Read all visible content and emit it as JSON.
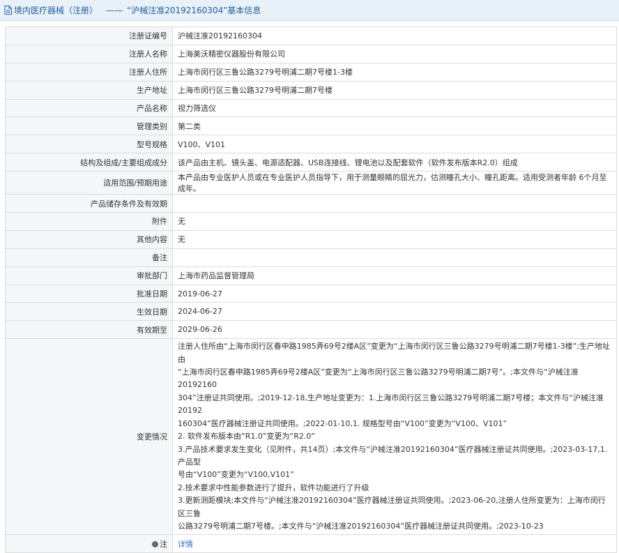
{
  "header": {
    "title": "境内医疗器械（注册）",
    "sep": "——",
    "subtitle": "“沪械注准20192160304”基本信息"
  },
  "rows": [
    {
      "label": "注册证编号",
      "value": "沪械注准20192160304"
    },
    {
      "label": "注册人名称",
      "value": "上海美沃精密仪器股份有限公司"
    },
    {
      "label": "注册人住所",
      "value": "上海市闵行区三鲁公路3279号明浦二期7号楼1-3楼"
    },
    {
      "label": "生产地址",
      "value": "上海市闵行区三鲁公路3279号明浦二期7号楼"
    },
    {
      "label": "产品名称",
      "value": "视力筛选仪"
    },
    {
      "label": "管理类别",
      "value": "第二类"
    },
    {
      "label": "型号规格",
      "value": "V100、V101"
    },
    {
      "label": "结构及组成/主要组成成分",
      "value": "该产品由主机、镜头盖、电源适配器、USB连接线、锂电池以及配套软件（软件发布版本R2.0）组成"
    },
    {
      "label": "适用范围/预期用途",
      "value": "本产品由专业医护人员或在专业医护人员指导下，用于测量眼睛的屈光力，估测瞳孔大小、瞳孔距离。适用受测者年龄 6个月至成年。"
    },
    {
      "label": "产品储存条件及有效期",
      "value": ""
    },
    {
      "label": "附件",
      "value": "无"
    },
    {
      "label": "其他内容",
      "value": "无"
    },
    {
      "label": "备注",
      "value": ""
    },
    {
      "label": "审批部门",
      "value": "上海市药品监督管理局"
    },
    {
      "label": "批准日期",
      "value": "2019-06-27"
    },
    {
      "label": "生效日期",
      "value": "2024-06-27"
    },
    {
      "label": "有效期至",
      "value": "2029-06-26"
    }
  ],
  "changes": {
    "label": "变更情况",
    "lines": [
      "注册人住所由“上海市闵行区春申路1985弄69号2楼A区”变更为“上海市闵行区三鲁公路3279号明浦二期7号楼1-3楼”;生产地址由",
      "“上海市闵行区春申路1985弄69号2楼A区”变更为“上海市闵行区三鲁公路3279号明浦二期7号”。;本文件与“沪械注准20192160",
      "304”注册证共同使用。;2019-12-18,生产地址变更为：1.上海市闵行区三鲁公路3279号明浦二期7号楼；本文件与“沪械注准20192",
      "160304”医疗器械注册证共同使用。;2022-01-10,1. 规格型号由“V100”变更为“V100、V101”",
      "2. 软件发布版本由“R1.0”变更为“R2.0”",
      "3.产品技术要求发生变化（见附件，共14页）;本文件与“沪械注准20192160304”医疗器械注册证共同使用。;2023-03-17,1.产品型",
      "号由“V100”变更为“V100,V101”",
      "2.技术要求中性能参数进行了提升，软件功能进行了升级",
      "3.更新测距模块;本文件与“沪械注准20192160304”医疗器械注册证共同使用。;2023-06-20,注册人住所变更为：上海市闵行区三鲁",
      "公路3279号明浦二期7号楼。;本文件与“沪械注准20192160304”医疗器械注册证共同使用。;2023-10-23"
    ]
  },
  "note": {
    "icon": "pin-icon",
    "label": "注",
    "link": "详情"
  }
}
